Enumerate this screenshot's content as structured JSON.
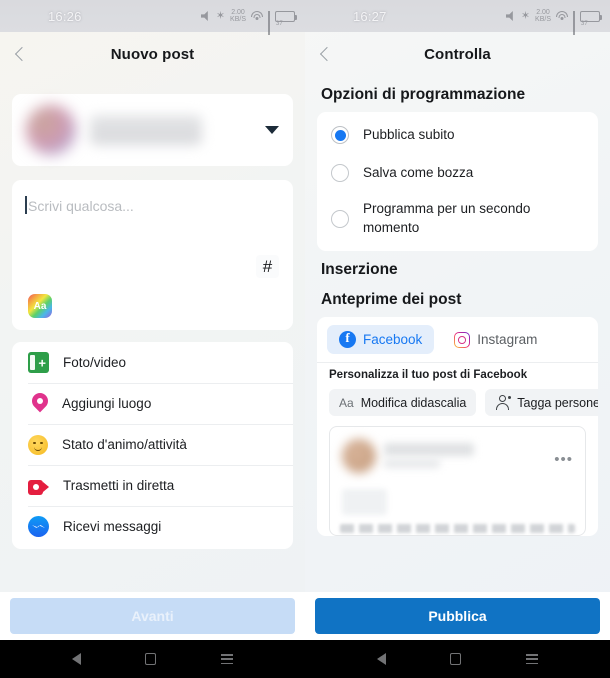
{
  "left": {
    "status": {
      "time": "16:26",
      "battery": "37"
    },
    "header": {
      "title": "Nuovo post",
      "back_icon": "chevron-left-icon"
    },
    "composer": {
      "placeholder": "Scrivi qualcosa...",
      "hash_label": "#",
      "aa_label": "Aa"
    },
    "options": [
      {
        "label": "Foto/video",
        "icon": "photo-video-icon"
      },
      {
        "label": "Aggiungi luogo",
        "icon": "location-pin-icon"
      },
      {
        "label": "Stato d'animo/attività",
        "icon": "smiley-icon"
      },
      {
        "label": "Trasmetti in diretta",
        "icon": "live-video-icon"
      },
      {
        "label": "Ricevi messaggi",
        "icon": "messenger-icon"
      }
    ],
    "bottom": {
      "next_label": "Avanti"
    },
    "nav": {
      "back": "nav-back-icon",
      "home": "nav-home-icon",
      "recents": "nav-recents-icon"
    }
  },
  "right": {
    "status": {
      "time": "16:27",
      "battery": "37"
    },
    "header": {
      "title": "Controlla",
      "back_icon": "chevron-left-icon"
    },
    "scheduling": {
      "title": "Opzioni di programmazione",
      "options": [
        {
          "label": "Pubblica subito",
          "selected": true
        },
        {
          "label": "Salva come bozza",
          "selected": false
        },
        {
          "label": "Programma per un secondo momento",
          "selected": false
        }
      ]
    },
    "ad_section": {
      "title": "Inserzione"
    },
    "previews": {
      "title": "Anteprime dei post",
      "tabs": [
        {
          "label": "Facebook",
          "icon": "facebook-icon",
          "active": true
        },
        {
          "label": "Instagram",
          "icon": "instagram-icon",
          "active": false
        }
      ],
      "subhead": "Personalizza il tuo post di Facebook",
      "chips": [
        {
          "label": "Modifica didascalia",
          "icon": "aa-icon",
          "prefix": "Aa"
        },
        {
          "label": "Tagga persone",
          "icon": "tag-person-icon"
        }
      ],
      "card_menu": "•••"
    },
    "bottom": {
      "publish_label": "Pubblica"
    }
  },
  "colors": {
    "accent_blue": "#1778f2",
    "primary_button": "#1073c4",
    "disabled_button": "#c6dcf6"
  }
}
